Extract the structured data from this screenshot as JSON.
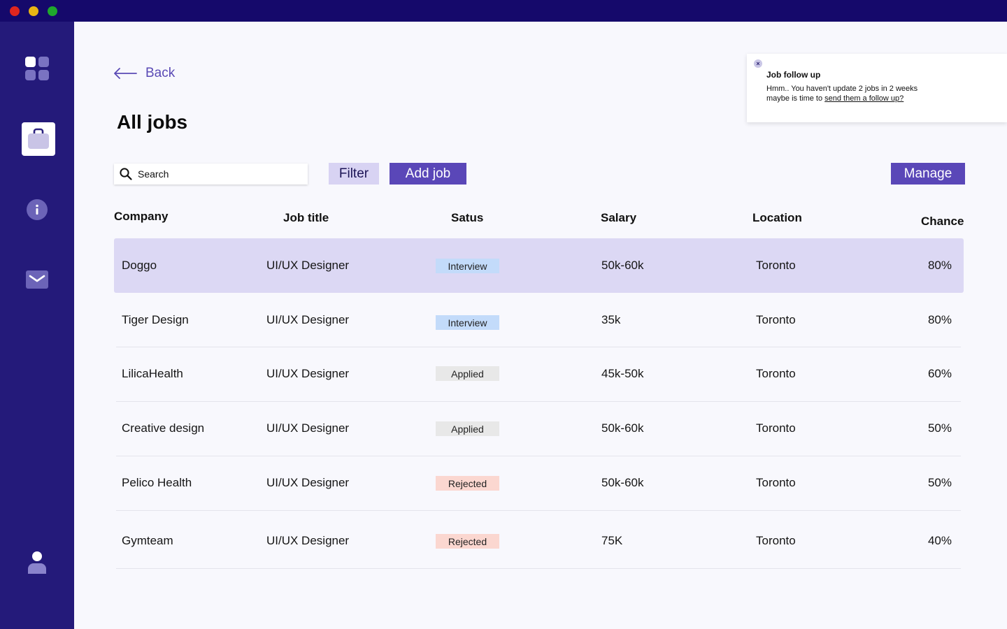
{
  "window": {
    "controls": [
      "close",
      "minimize",
      "maximize"
    ]
  },
  "sidebar": {
    "items": [
      {
        "icon": "grid-icon"
      },
      {
        "icon": "briefcase-icon",
        "active": true
      },
      {
        "icon": "info-icon"
      },
      {
        "icon": "mail-icon"
      },
      {
        "icon": "user-icon"
      }
    ]
  },
  "header": {
    "back_label": "Back",
    "title": "All jobs"
  },
  "toolbar": {
    "search_placeholder": "Search",
    "filter_label": "Filter",
    "add_label": "Add job",
    "manage_label": "Manage"
  },
  "table": {
    "columns": [
      "Company",
      "Job title",
      "Satus",
      "Salary",
      "Location",
      "Chance"
    ],
    "rows": [
      {
        "company": "Doggo",
        "title": "UI/UX Designer",
        "status": "Interview",
        "salary": "50k-60k",
        "location": "Toronto",
        "chance": "80%"
      },
      {
        "company": "Tiger Design",
        "title": "UI/UX Designer",
        "status": "Interview",
        "salary": "35k",
        "location": "Toronto",
        "chance": "80%"
      },
      {
        "company": "LilicaHealth",
        "title": "UI/UX Designer",
        "status": "Applied",
        "salary": "45k-50k",
        "location": "Toronto",
        "chance": "60%"
      },
      {
        "company": "Creative design",
        "title": "UI/UX Designer",
        "status": "Applied",
        "salary": "50k-60k",
        "location": "Toronto",
        "chance": "50%"
      },
      {
        "company": "Pelico Health",
        "title": "UI/UX Designer",
        "status": "Rejected",
        "salary": "50k-60k",
        "location": "Toronto",
        "chance": "50%"
      },
      {
        "company": "Gymteam",
        "title": "UI/UX Designer",
        "status": "Rejected",
        "salary": "75K",
        "location": "Toronto",
        "chance": "40%"
      }
    ]
  },
  "toast": {
    "close_label": "×",
    "title": "Job follow up",
    "line1": "Hmm.. You haven't update 2 jobs in 2 weeks",
    "line2_prefix": "maybe is time to ",
    "link": "send them a follow up?"
  },
  "colors": {
    "titlebar": "#15096b",
    "sidebar": "#241a7a",
    "accent": "#5a47b8",
    "filter_bg": "#d8d3f3",
    "selected_row": "#dcd8f4",
    "status_interview": "#c3dbfa",
    "status_applied": "#e8e8e8",
    "status_rejected": "#fbd7d0"
  }
}
